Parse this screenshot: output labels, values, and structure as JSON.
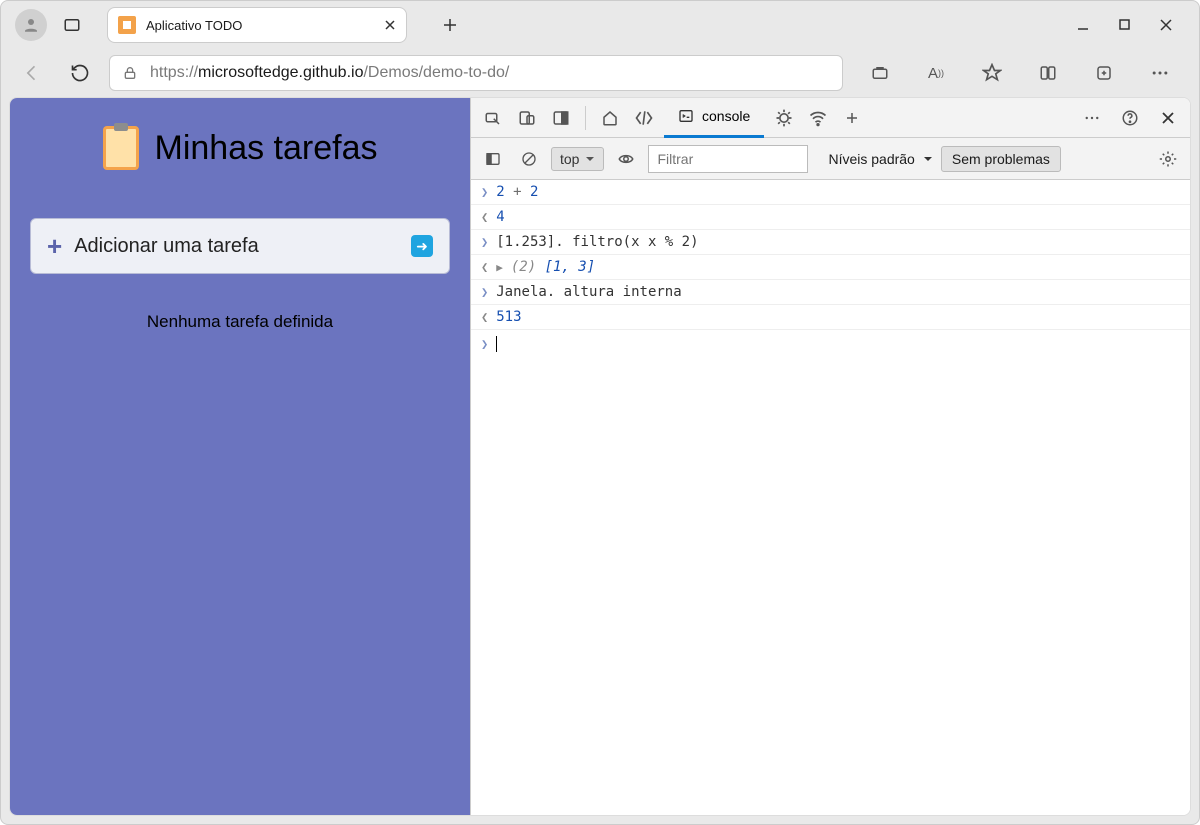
{
  "browser": {
    "tab_title": "Aplicativo TODO",
    "url_prefix": "https://",
    "url_host": "microsoftedge.github.io",
    "url_path": "/Demos/demo-to-do/"
  },
  "app": {
    "title": "Minhas tarefas",
    "add_label": "Adicionar uma tarefa",
    "empty": "Nenhuma tarefa definida"
  },
  "devtools": {
    "tab_label": "console",
    "context": "top",
    "filter_placeholder": "Filtrar",
    "levels": "Níveis padrão",
    "issues": "Sem problemas",
    "lines": {
      "l1a": "2",
      "l1op": " + ",
      "l1b": "2",
      "l1out": "4",
      "l2in": "[1.253]. filtro(x x % 2)",
      "l2count": "(2) ",
      "l2arr": "[1, 3]",
      "l3in": "Janela. altura interna",
      "l3out": "513"
    }
  }
}
